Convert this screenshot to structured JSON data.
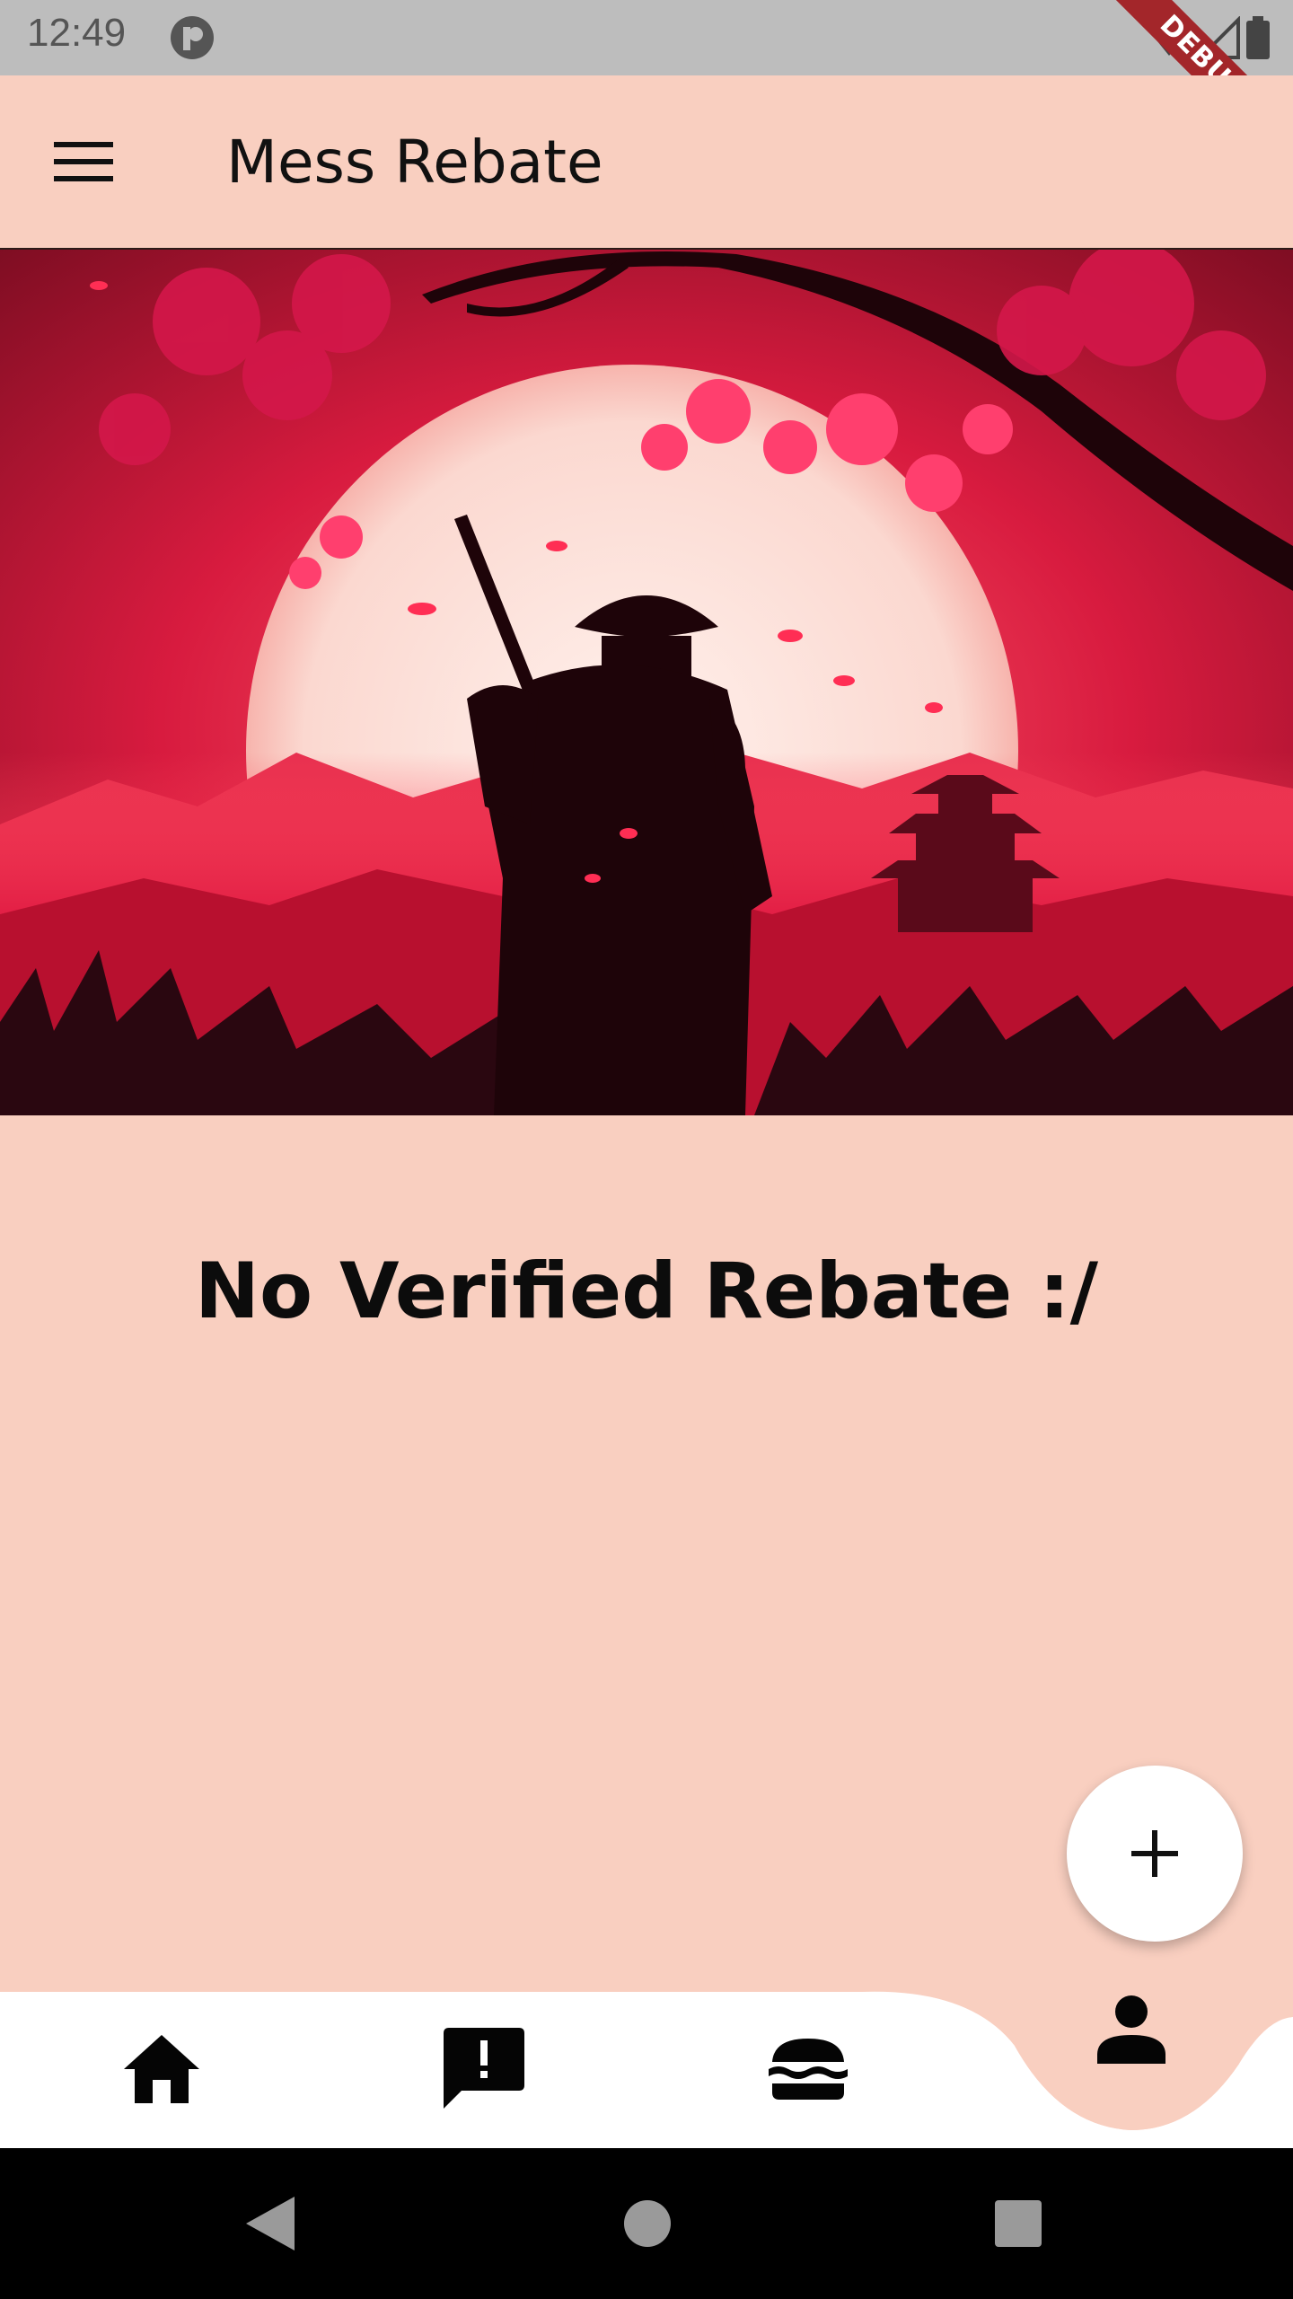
{
  "status_bar": {
    "time": "12:49",
    "debug_label": "DEBUG",
    "icons": [
      "notification-icon",
      "wifi-icon",
      "signal-icon",
      "battery-icon"
    ]
  },
  "app_bar": {
    "title": "Mess Rebate",
    "menu_icon": "menu-icon"
  },
  "main": {
    "empty_message": "No Verified Rebate :/"
  },
  "fab": {
    "icon": "plus-icon"
  },
  "bottom_nav": {
    "items": [
      {
        "icon": "home-icon",
        "selected": false
      },
      {
        "icon": "feedback-icon",
        "selected": false
      },
      {
        "icon": "burger-icon",
        "selected": false
      },
      {
        "icon": "person-icon",
        "selected": true
      }
    ]
  },
  "system_nav": {
    "buttons": [
      "back-icon",
      "home-circle-icon",
      "recents-icon"
    ]
  },
  "colors": {
    "background": "#f9cfc0",
    "nav_background": "#ffffff",
    "hero_red": "#b01635",
    "text": "#0c0c0c"
  }
}
